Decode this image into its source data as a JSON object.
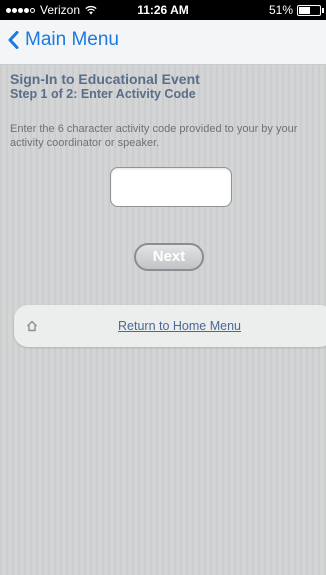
{
  "status_bar": {
    "carrier": "Verizon",
    "time": "11:26 AM",
    "battery": "51%",
    "signal_bars": 4,
    "battery_level": 0.51
  },
  "nav": {
    "back_label": "Main Menu"
  },
  "page": {
    "title": "Sign-In to Educational Event",
    "subtitle": "Step 1 of 2: Enter Activity Code",
    "instructions": "Enter the 6 character activity code provided to your by your activity coordinator or speaker."
  },
  "form": {
    "code_value": "",
    "code_placeholder": "",
    "next_label": "Next"
  },
  "home": {
    "link_label": "Return to Home Menu"
  },
  "colors": {
    "accent": "#1a7ae0",
    "heading": "#5a6e8a",
    "link": "#4a6a95"
  }
}
